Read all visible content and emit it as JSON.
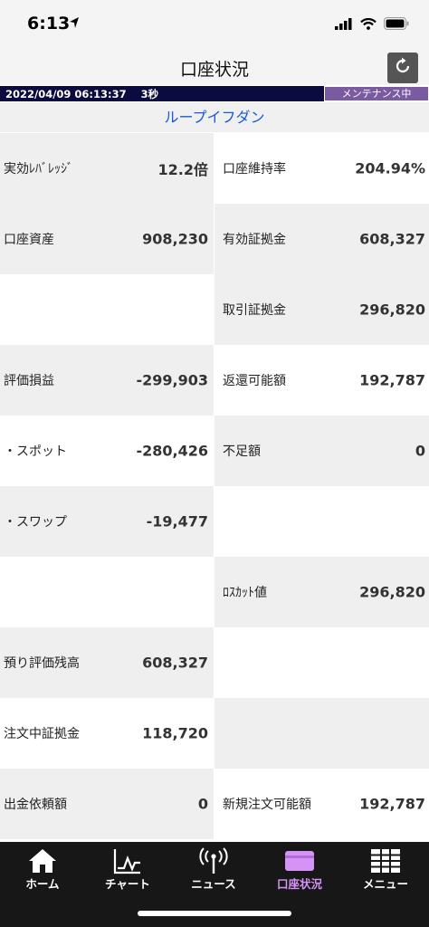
{
  "status_bar": {
    "time": "6:13"
  },
  "header": {
    "title": "口座状況"
  },
  "info_strip": {
    "datetime": "2022/04/09 06:13:37",
    "interval": "3秒",
    "badge": "メンテナンス中"
  },
  "subheader": {
    "title": "ループイフダン"
  },
  "left_cells": [
    {
      "label": "実効ﾚﾊﾞﾚｯｼﾞ",
      "value": "12.2倍"
    },
    {
      "label": "口座資産",
      "value": "908,230"
    },
    {
      "label": "",
      "value": ""
    },
    {
      "label": "評価損益",
      "value": "-299,903"
    },
    {
      "label": "・スポット",
      "value": "-280,426"
    },
    {
      "label": "・スワップ",
      "value": "-19,477"
    },
    {
      "label": "",
      "value": ""
    },
    {
      "label": "預り評価残高",
      "value": "608,327"
    },
    {
      "label": "注文中証拠金",
      "value": "118,720"
    },
    {
      "label": "出金依頼額",
      "value": "0"
    }
  ],
  "right_cells": [
    {
      "label": "口座維持率",
      "value": "204.94%"
    },
    {
      "label": "有効証拠金",
      "value": "608,327"
    },
    {
      "label": "取引証拠金",
      "value": "296,820"
    },
    {
      "label": "返還可能額",
      "value": "192,787"
    },
    {
      "label": "不足額",
      "value": "0"
    },
    {
      "label": "",
      "value": ""
    },
    {
      "label": "ﾛｽｶｯﾄ値",
      "value": "296,820"
    },
    {
      "label": "",
      "value": ""
    },
    {
      "label": "",
      "value": ""
    },
    {
      "label": "新規注文可能額",
      "value": "192,787"
    }
  ],
  "tabs": [
    {
      "label": "ホーム",
      "icon": "home-icon"
    },
    {
      "label": "チャート",
      "icon": "chart-icon"
    },
    {
      "label": "ニュース",
      "icon": "antenna-icon"
    },
    {
      "label": "口座状況",
      "icon": "account-icon",
      "active": true
    },
    {
      "label": "メニュー",
      "icon": "grid-menu-icon"
    }
  ],
  "colors": {
    "accent": "#d792f5",
    "subheader_text": "#1a5ad8",
    "strip_bg": "#0b0b3f",
    "badge_bg": "#7a5aa0"
  }
}
